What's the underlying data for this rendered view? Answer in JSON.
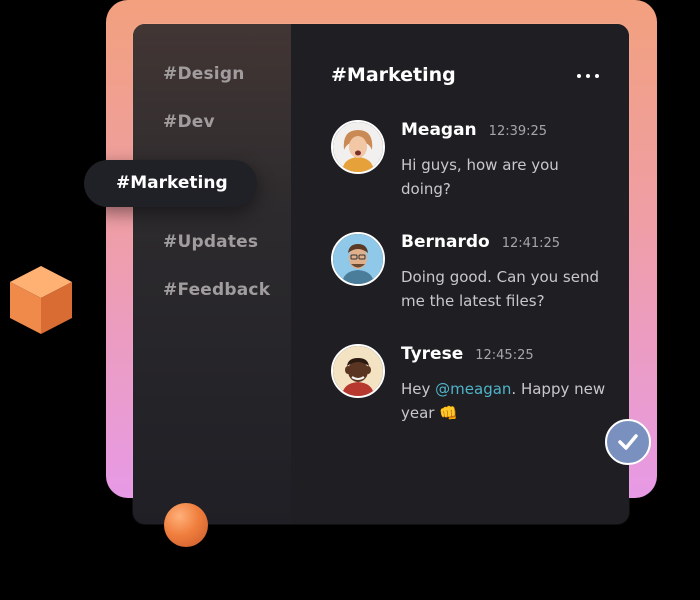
{
  "sidebar": {
    "channels": [
      {
        "label": "#Design"
      },
      {
        "label": "#Dev"
      },
      {
        "label": "#Marketing"
      },
      {
        "label": "#Updates"
      },
      {
        "label": "#Feedback"
      }
    ]
  },
  "chat": {
    "title": "#Marketing",
    "messages": [
      {
        "name": "Meagan",
        "time": "12:39:25",
        "text": "Hi guys, how are you doing?"
      },
      {
        "name": "Bernardo",
        "time": "12:41:25",
        "text": "Doing good. Can you send me the latest files?"
      },
      {
        "name": "Tyrese",
        "time": "12:45:25",
        "text_before": "Hey ",
        "mention": "@meagan",
        "text_after": ". Happy new year ",
        "emoji": "👊"
      }
    ]
  },
  "icons": {
    "more": "more-horizontal-icon",
    "check": "check-icon",
    "cube": "cube-icon",
    "sphere": "sphere-icon"
  },
  "colors": {
    "accent_mention": "#4fb3c9",
    "check_badge": "#7a90bf",
    "gradient_top": "#f2a07e",
    "gradient_bottom": "#e79ae6",
    "panel": "#1e1e23"
  }
}
